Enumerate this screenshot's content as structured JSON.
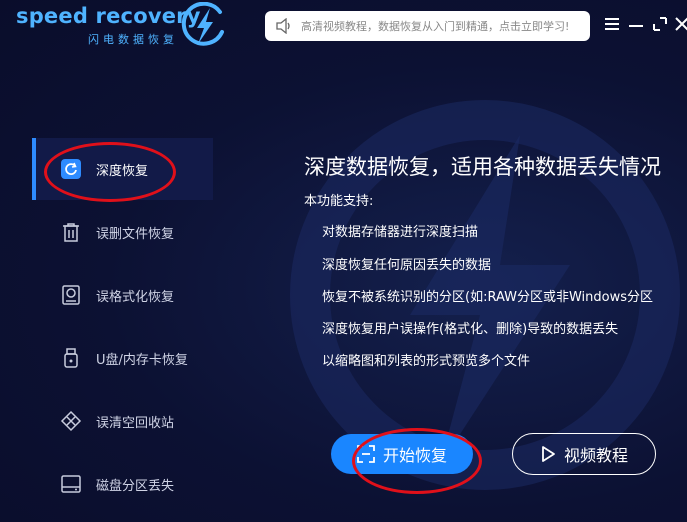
{
  "app": {
    "logo_text": "speed recovery",
    "logo_sub": "闪电数据恢复"
  },
  "header": {
    "notice_text": "高清视频教程，数据恢复从入门到精通，点击立即学习!",
    "menu_icon": "menu-icon",
    "minimize_icon": "minimize-icon",
    "maximize_icon": "maximize-icon",
    "close_icon": "close-icon"
  },
  "sidebar": {
    "items": [
      {
        "label": "深度恢复",
        "icon": "deep-recovery-icon",
        "active": true
      },
      {
        "label": "误删文件恢复",
        "icon": "trash-icon",
        "active": false
      },
      {
        "label": "误格式化恢复",
        "icon": "format-disk-icon",
        "active": false
      },
      {
        "label": "U盘/内存卡恢复",
        "icon": "usb-drive-icon",
        "active": false
      },
      {
        "label": "误清空回收站",
        "icon": "recycle-bin-icon",
        "active": false
      },
      {
        "label": "磁盘分区丢失",
        "icon": "disk-partition-icon",
        "active": false
      }
    ]
  },
  "main": {
    "title": "深度数据恢复，适用各种数据丢失情况",
    "support_label": "本功能支持:",
    "features": [
      "对数据存储器进行深度扫描",
      "深度恢复任何原因丢失的数据",
      "恢复不被系统识别的分区(如:RAW分区或非Windows分区",
      "深度恢复用户误操作(格式化、删除)导致的数据丢失",
      "以缩略图和列表的形式预览多个文件"
    ],
    "start_button": "开始恢复",
    "video_button": "视频教程"
  },
  "colors": {
    "background": "#0b0f2e",
    "accent": "#1a86ff",
    "logo": "#4fb3ff",
    "annotation": "#e0101a"
  }
}
